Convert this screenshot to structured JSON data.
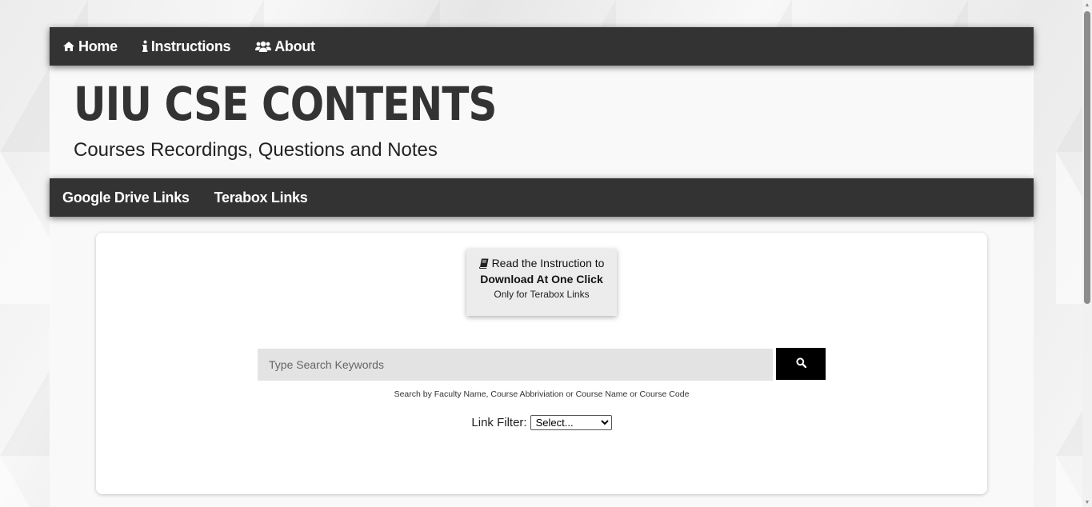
{
  "nav": {
    "items": [
      {
        "label": "Home",
        "icon": "home-icon"
      },
      {
        "label": "Instructions",
        "icon": "info-icon"
      },
      {
        "label": "About",
        "icon": "users-icon"
      }
    ]
  },
  "header": {
    "title": "UIU CSE CONTENTS",
    "subtitle": "Courses Recordings, Questions and Notes"
  },
  "subnav": {
    "items": [
      {
        "label": "Google Drive Links"
      },
      {
        "label": "Terabox Links"
      }
    ]
  },
  "instruction": {
    "line1": "Read the Instruction to",
    "line2": "Download At One Click",
    "line3": "Only for Terabox Links",
    "icon": "book-icon"
  },
  "search": {
    "placeholder": "Type Search Keywords",
    "value": "",
    "button_icon": "search-icon",
    "hint": "Search by Faculty Name, Course Abbriviation or Course Name or Course Code"
  },
  "filter": {
    "label": "Link Filter:",
    "selected": "Select..."
  },
  "colors": {
    "nav_bg": "#333333",
    "nav_text": "#ffffff",
    "title": "#333333",
    "search_button": "#000000",
    "input_bg": "#e3e3e3"
  }
}
